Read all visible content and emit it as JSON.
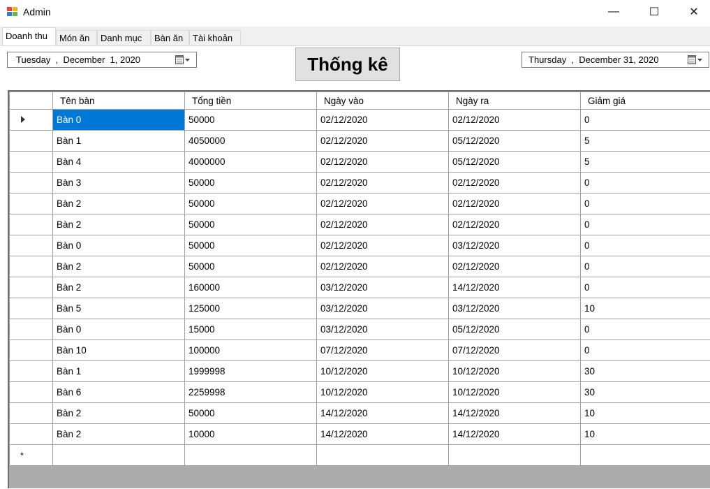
{
  "window": {
    "title": "Admin",
    "minimize_glyph": "—",
    "maximize_glyph": "☐",
    "close_glyph": "✕"
  },
  "tabs": [
    {
      "label": "Doanh thu",
      "active": true
    },
    {
      "label": "Món ăn",
      "active": false
    },
    {
      "label": "Danh mục",
      "active": false
    },
    {
      "label": "Bàn ăn",
      "active": false
    },
    {
      "label": "Tài khoản",
      "active": false
    }
  ],
  "date_from": {
    "day": "Tuesday",
    "month_date": "December  1, 2020",
    "icon": "calendar-icon"
  },
  "date_to": {
    "day": "Thursday",
    "month_date": "December 31, 2020",
    "icon": "calendar-icon"
  },
  "stat_button_label": "Thống kê",
  "grid": {
    "columns": [
      "Tên bàn",
      "Tổng tiền",
      "Ngày vào",
      "Ngày ra",
      "Giảm giá"
    ],
    "rows": [
      [
        "Bàn 0",
        "50000",
        "02/12/2020",
        "02/12/2020",
        "0"
      ],
      [
        "Bàn 1",
        "4050000",
        "02/12/2020",
        "05/12/2020",
        "5"
      ],
      [
        "Bàn 4",
        "4000000",
        "02/12/2020",
        "05/12/2020",
        "5"
      ],
      [
        "Bàn 3",
        "50000",
        "02/12/2020",
        "02/12/2020",
        "0"
      ],
      [
        "Bàn 2",
        "50000",
        "02/12/2020",
        "02/12/2020",
        "0"
      ],
      [
        "Bàn 2",
        "50000",
        "02/12/2020",
        "02/12/2020",
        "0"
      ],
      [
        "Bàn 0",
        "50000",
        "02/12/2020",
        "03/12/2020",
        "0"
      ],
      [
        "Bàn 2",
        "50000",
        "02/12/2020",
        "02/12/2020",
        "0"
      ],
      [
        "Bàn 2",
        "160000",
        "03/12/2020",
        "14/12/2020",
        "0"
      ],
      [
        "Bàn 5",
        "125000",
        "03/12/2020",
        "03/12/2020",
        "10"
      ],
      [
        "Bàn 0",
        "15000",
        "03/12/2020",
        "05/12/2020",
        "0"
      ],
      [
        "Bàn 10",
        "100000",
        "07/12/2020",
        "07/12/2020",
        "0"
      ],
      [
        "Bàn 1",
        "1999998",
        "10/12/2020",
        "10/12/2020",
        "30"
      ],
      [
        "Bàn 6",
        "2259998",
        "10/12/2020",
        "10/12/2020",
        "30"
      ],
      [
        "Bàn 2",
        "50000",
        "14/12/2020",
        "14/12/2020",
        "10"
      ],
      [
        "Bàn 2",
        "10000",
        "14/12/2020",
        "14/12/2020",
        "10"
      ]
    ],
    "selected_row": 0,
    "new_row_marker": "*",
    "selection_color": "#0078d7"
  }
}
